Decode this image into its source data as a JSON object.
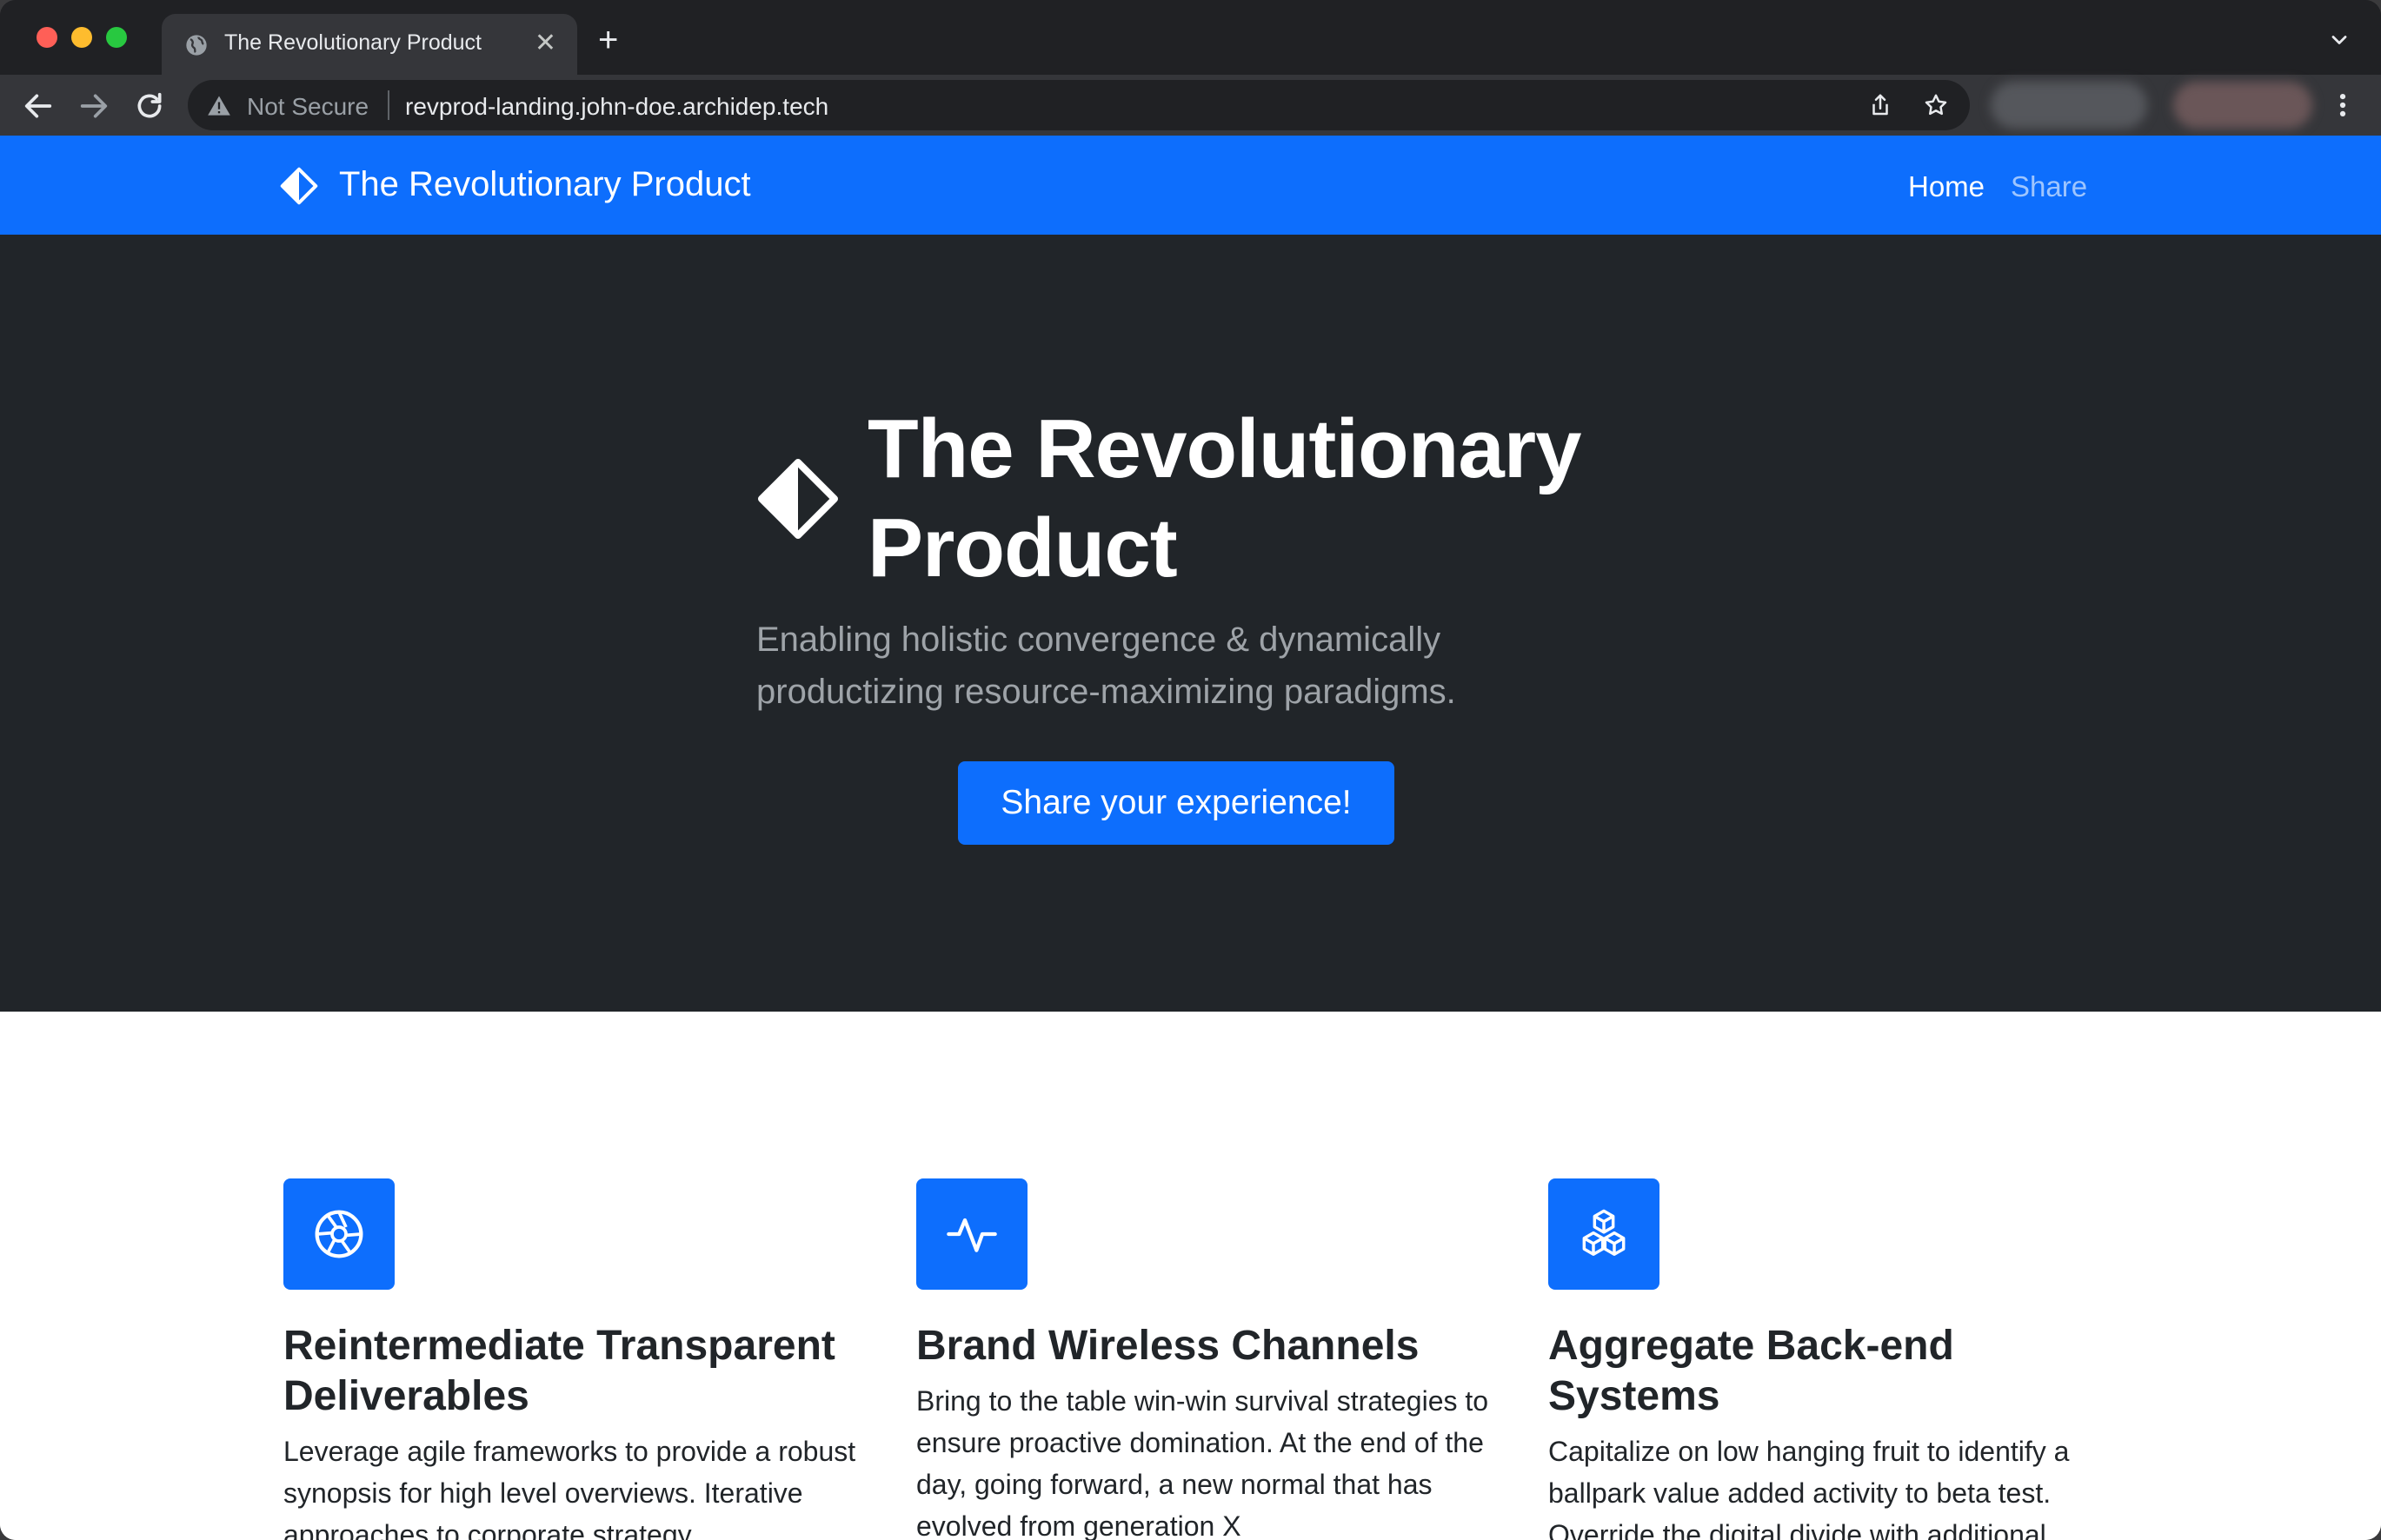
{
  "browser": {
    "tab_title": "The Revolutionary Product",
    "tab_close": "✕",
    "new_tab": "+",
    "security_label": "Not Secure",
    "url": "revprod-landing.john-doe.archidep.tech"
  },
  "navbar": {
    "brand": "The Revolutionary Product",
    "links": [
      {
        "label": "Home",
        "active": true
      },
      {
        "label": "Share",
        "active": false
      }
    ]
  },
  "hero": {
    "title": "The Revolutionary Product",
    "subtitle": "Enabling holistic convergence & dynamically productizing resource-maximizing paradigms.",
    "cta": "Share your experience!"
  },
  "features": [
    {
      "icon": "aperture-icon",
      "title": "Reintermediate Transparent Deliverables",
      "text": "Leverage agile frameworks to provide a robust synopsis for high level overviews. Iterative approaches to corporate strategy"
    },
    {
      "icon": "activity-icon",
      "title": "Brand Wireless Channels",
      "text": "Bring to the table win-win survival strategies to ensure proactive domination. At the end of the day, going forward, a new normal that has evolved from generation X"
    },
    {
      "icon": "boxes-icon",
      "title": "Aggregate Back-end Systems",
      "text": "Capitalize on low hanging fruit to identify a ballpark value added activity to beta test. Override the digital divide with additional"
    }
  ],
  "colors": {
    "primary": "#0d6efd",
    "hero_bg": "#212529",
    "browser_frame": "#202124",
    "toolbar": "#35363a"
  }
}
